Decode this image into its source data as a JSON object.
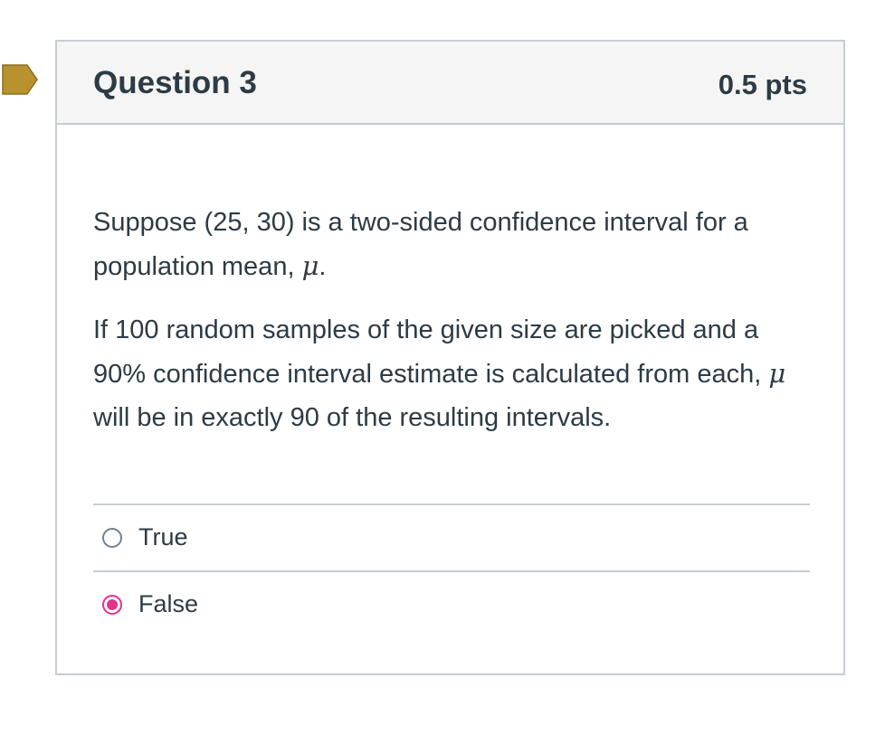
{
  "flag": {
    "color": "#b8922e",
    "icon": "flag-marker-icon"
  },
  "question": {
    "title": "Question 3",
    "points": "0.5 pts",
    "paragraph1_text": "Suppose (25, 30) is a two-sided confidence interval for a population mean, ",
    "paragraph1_symbol": "μ",
    "paragraph1_end": ".",
    "paragraph2_text": "If 100 random samples of the given size are picked and a 90% confidence interval estimate is calculated from each, ",
    "paragraph2_symbol": "μ",
    "paragraph2_end": " will be in exactly 90 of the resulting intervals."
  },
  "answers": [
    {
      "label": "True",
      "selected": false
    },
    {
      "label": "False",
      "selected": true
    }
  ],
  "colors": {
    "selected_radio": "#e0358b",
    "header_bg": "#f5f5f5",
    "border": "#c7cdd1",
    "text": "#2d3b45"
  }
}
